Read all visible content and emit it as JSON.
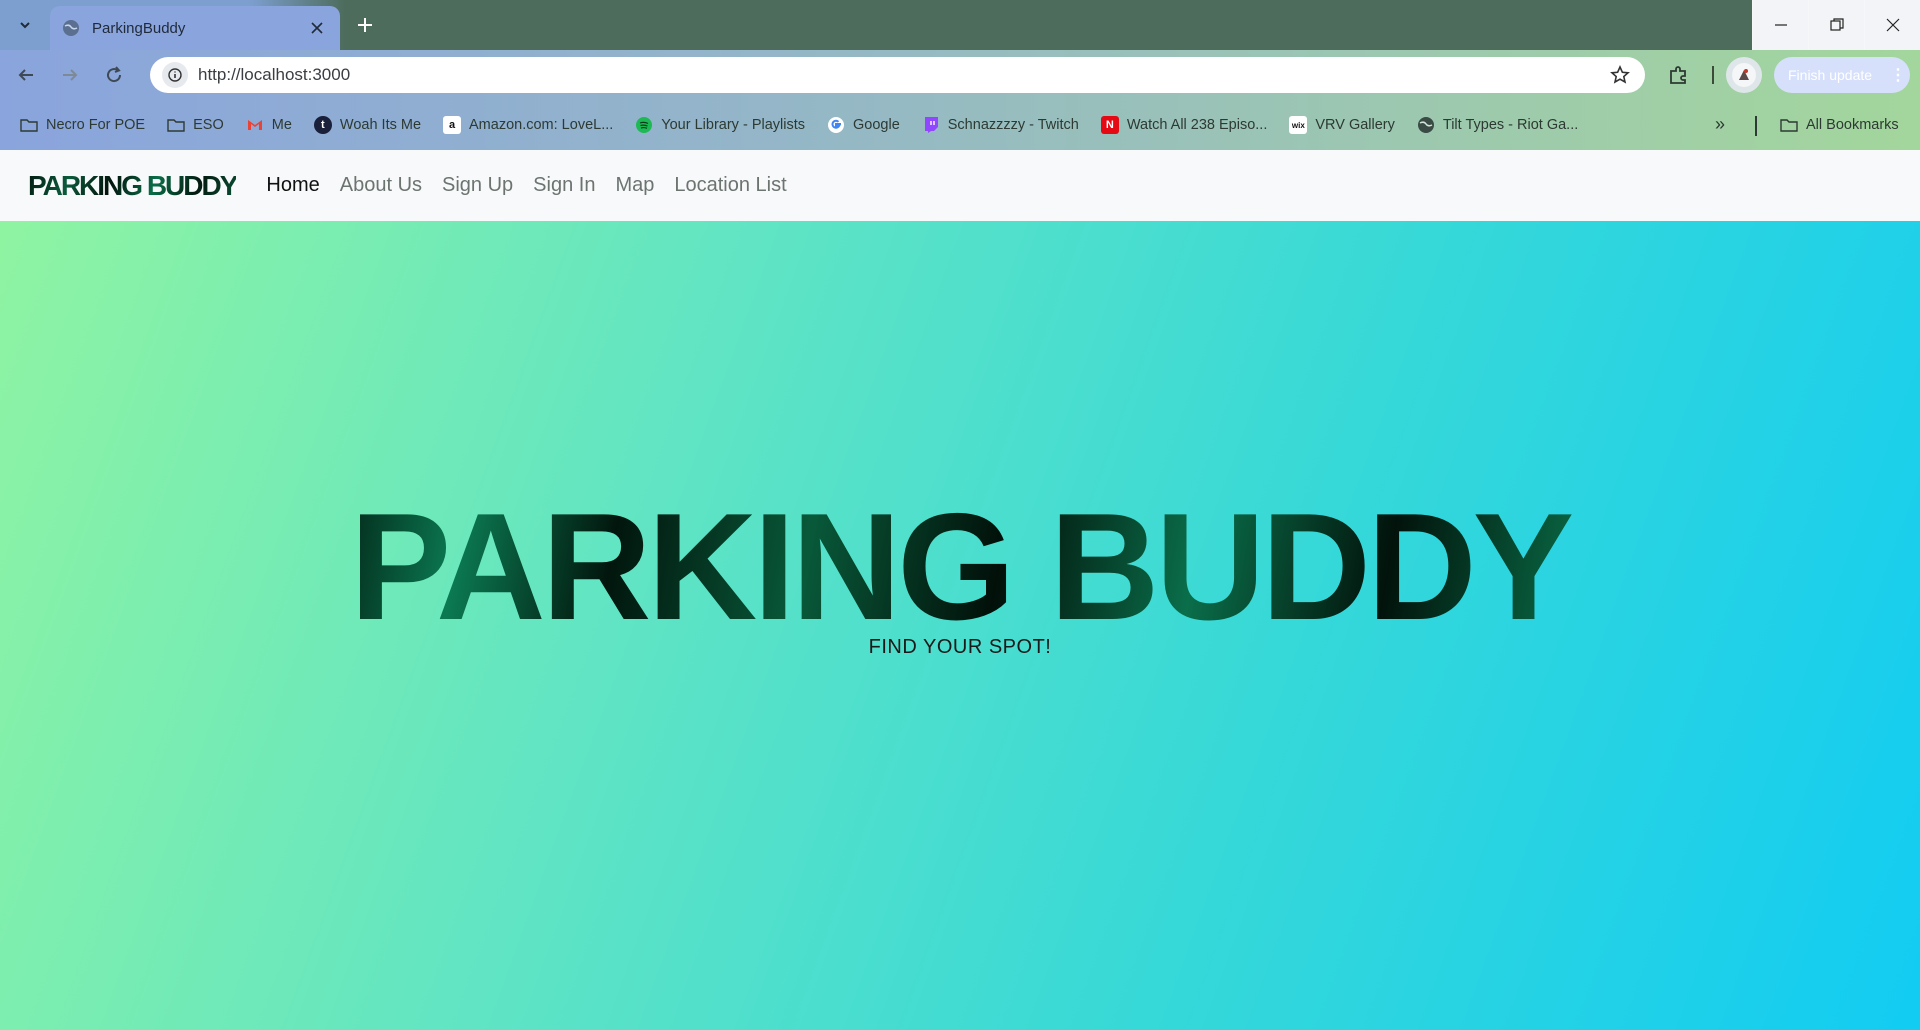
{
  "browser": {
    "tab": {
      "title": "ParkingBuddy"
    },
    "url": "http://localhost:3000",
    "update_button": "Finish update",
    "bookmarks": [
      {
        "label": "Necro For POE",
        "icon": "folder-icon"
      },
      {
        "label": "ESO",
        "icon": "folder-icon"
      },
      {
        "label": "Me",
        "icon": "gmail-icon"
      },
      {
        "label": "Woah Its Me",
        "icon": "tumblr-icon"
      },
      {
        "label": "Amazon.com: LoveL...",
        "icon": "amazon-icon"
      },
      {
        "label": "Your Library - Playlists",
        "icon": "spotify-icon"
      },
      {
        "label": "Google",
        "icon": "google-icon"
      },
      {
        "label": "Schnazzzzy - Twitch",
        "icon": "twitch-icon"
      },
      {
        "label": "Watch All 238 Episo...",
        "icon": "netflix-icon"
      },
      {
        "label": "VRV Gallery",
        "icon": "wix-icon"
      },
      {
        "label": "Tilt Types - Riot Ga...",
        "icon": "globe-icon"
      }
    ],
    "all_bookmarks": "All Bookmarks"
  },
  "site": {
    "brand": "PARKING BUDDY",
    "nav": [
      {
        "label": "Home",
        "active": true
      },
      {
        "label": "About Us",
        "active": false
      },
      {
        "label": "Sign Up",
        "active": false
      },
      {
        "label": "Sign In",
        "active": false
      },
      {
        "label": "Map",
        "active": false
      },
      {
        "label": "Location List",
        "active": false
      }
    ],
    "hero": {
      "title": "PARKING BUDDY",
      "subtitle": "FIND YOUR SPOT!"
    }
  },
  "colors": {
    "hero_gradient_start": "#8ff4a2",
    "hero_gradient_end": "#12ccf2",
    "brand_text": "#063d28"
  }
}
